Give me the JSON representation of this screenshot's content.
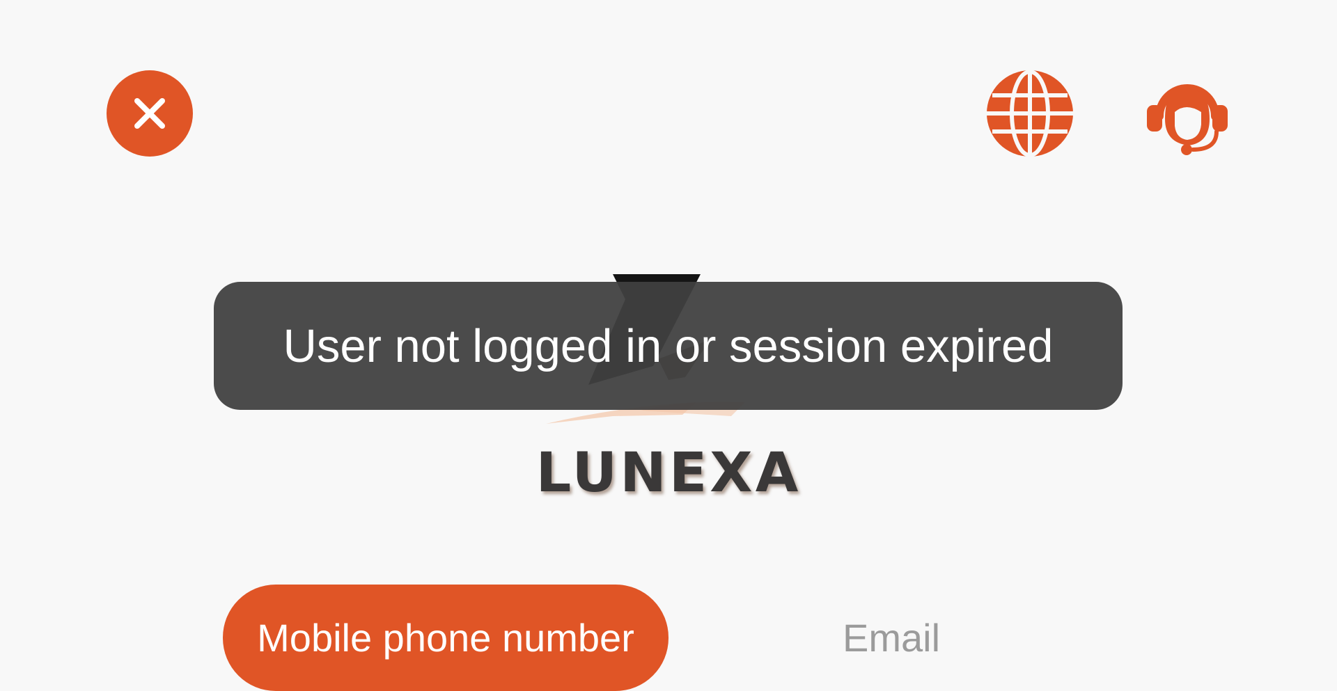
{
  "header": {
    "close_icon": "close-icon",
    "language_icon": "globe-icon",
    "support_icon": "customer-service-headset-icon",
    "accent_color": "#e05526"
  },
  "brand": {
    "logo_text": "LUNEXA"
  },
  "toast": {
    "message": "User not logged in or session expired"
  },
  "login_tabs": [
    {
      "label": "Mobile phone number",
      "selected": true
    },
    {
      "label": "Email",
      "selected": false
    }
  ]
}
